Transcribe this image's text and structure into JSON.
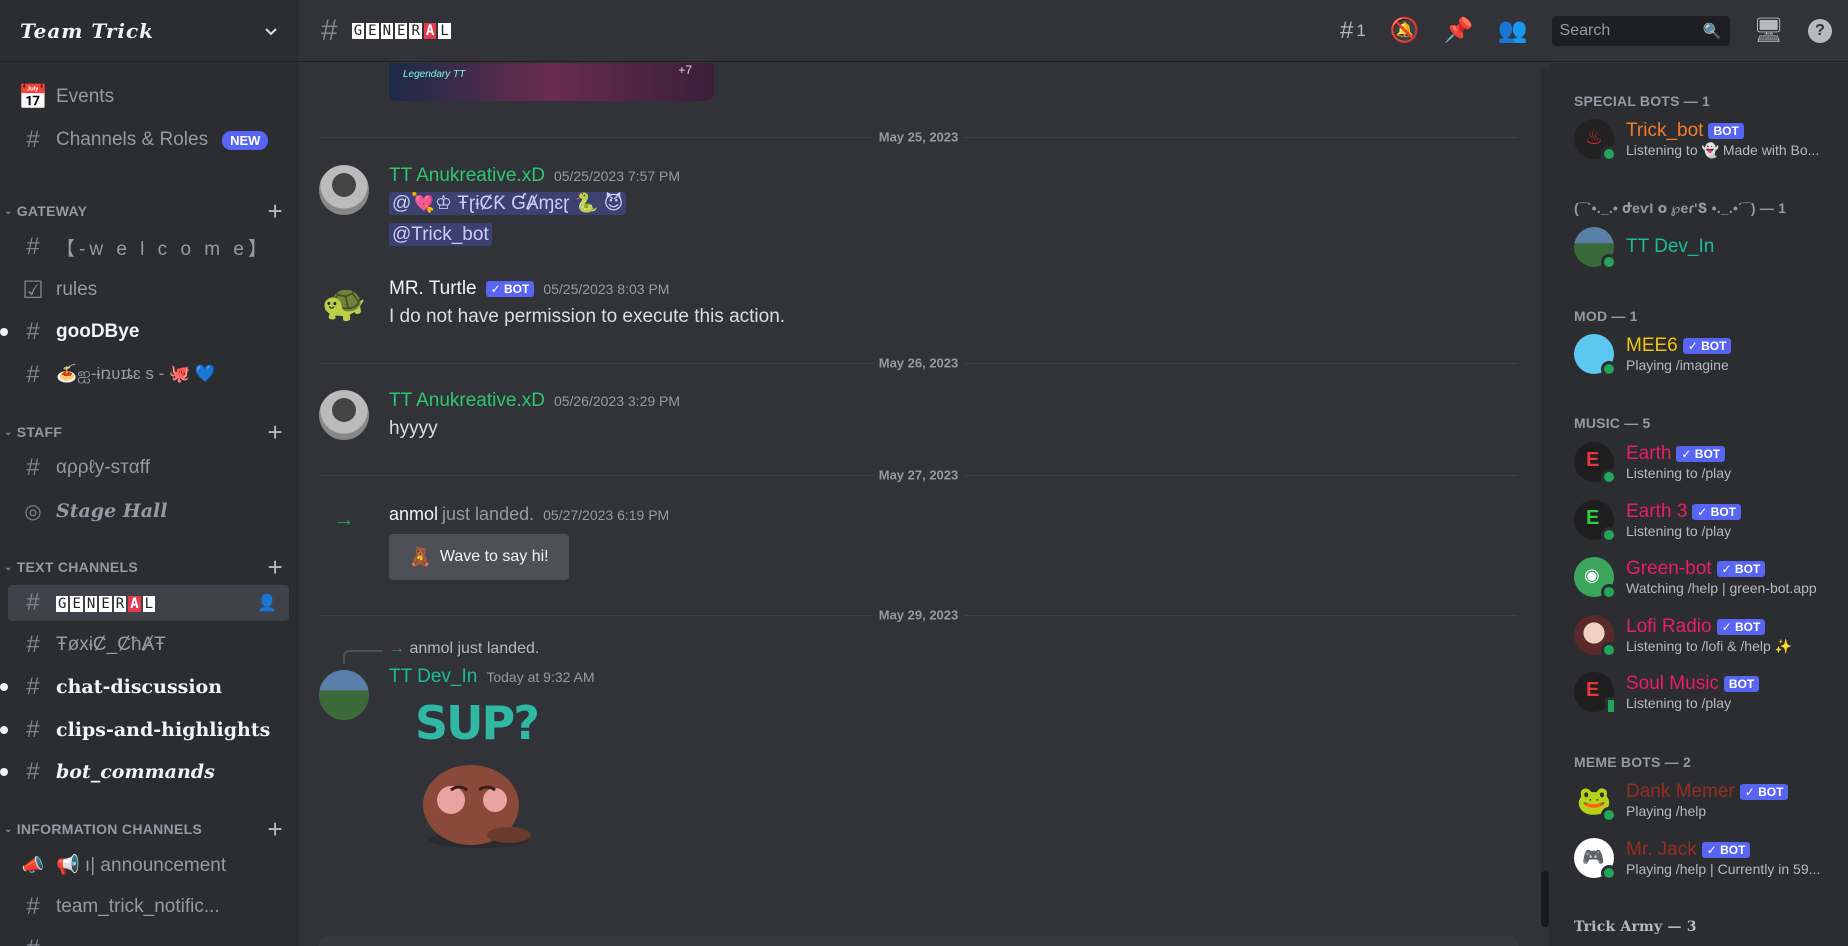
{
  "server": {
    "name": "Team Trick"
  },
  "sidebar": {
    "events_label": "Events",
    "channels_roles_label": "Channels & Roles",
    "new_badge": "NEW",
    "categories": {
      "gateway": "GATEWAY",
      "staff": "STAFF",
      "text_channels": "TEXT CHANNELS",
      "information_channels": "INFORMATION CHANNELS"
    },
    "channels": {
      "welcome": "【-w e l c o m e】",
      "rules": "rules",
      "goodbye": "gooDBye",
      "invites": "🍝ஐ-ɨռʋɪȶɛ ѕ - 🐙 💙",
      "apply_staff": "αρρℓу-ѕтαff",
      "stage_hall": "Stage Hall",
      "general": "GENERAL",
      "toxic_chat": "ŦøxɨȻ_ȻħȺŦ",
      "chat_discussion": "chat-discussion",
      "clips": "clips-and-highlights",
      "bot_commands": "bot_commands",
      "announcement": "📢 ı| announcement",
      "notifications": "team_trick_notific..."
    }
  },
  "topbar": {
    "channel": "GENERAL",
    "threads_count": "1",
    "search_placeholder": "Search"
  },
  "chat": {
    "embed_text": "Legendary TT",
    "embed_more": "+7",
    "dividers": [
      "May 25, 2023",
      "May 26, 2023",
      "May 27, 2023",
      "May 29, 2023"
    ],
    "messages": [
      {
        "author": "TT Anukreative.xD",
        "timestamp": "05/25/2023 7:57 PM",
        "mention1": "@💘♔ ŦɽɨȻƘ ƓȺɱɛɽ 🐍 😈",
        "mention2": "@Trick_bot"
      },
      {
        "author": "MR. Turtle",
        "bot": "✓ BOT",
        "timestamp": "05/25/2023 8:03 PM",
        "text": "I do not have permission to execute this action."
      },
      {
        "author": "TT Anukreative.xD",
        "timestamp": "05/26/2023 3:29 PM",
        "text": "hyyyy"
      },
      {
        "author": "anmol",
        "action": "just landed.",
        "timestamp": "05/27/2023 6:19 PM",
        "button": "Wave to say hi!"
      },
      {
        "reply": "anmol just landed.",
        "author": "TT Dev_In",
        "timestamp": "Today at 9:32 AM",
        "sticker_text": "SUP?"
      }
    ]
  },
  "members": {
    "groups": [
      {
        "title": "SPECIAL BOTS — 1"
      },
      {
        "title": "(¯`•._.• ժeѵӀ օ ℘eɾ'Տ •._.•´¯) — 1"
      },
      {
        "title": "MOD — 1"
      },
      {
        "title": "MUSIC — 5"
      },
      {
        "title": "MEME BOTS — 2"
      },
      {
        "title": "Trick Army — 3"
      }
    ],
    "list": [
      {
        "name": "Trick_bot",
        "bot": "BOT",
        "activity": "Listening to 👻 Made with Bo...",
        "color": "#f47b28"
      },
      {
        "name": "TT Dev_In",
        "activity": "",
        "color": "#1abc9c"
      },
      {
        "name": "MEE6",
        "bot": "✓ BOT",
        "activity": "Playing /imagine",
        "color": "#f1c40f"
      },
      {
        "name": "Earth",
        "bot": "✓ BOT",
        "activity": "Listening to /play",
        "color": "#e91e63"
      },
      {
        "name": "Earth 3",
        "bot": "✓ BOT",
        "activity": "Listening to /play",
        "color": "#e91e63"
      },
      {
        "name": "Green-bot",
        "bot": "✓ BOT",
        "activity": "Watching /help | green-bot.app",
        "color": "#e91e63"
      },
      {
        "name": "Lofi Radio",
        "bot": "✓ BOT",
        "activity": "Listening to /lofi & /help ✨",
        "color": "#e91e63"
      },
      {
        "name": "Soul Music",
        "bot": "BOT",
        "activity": "Listening to /play",
        "color": "#e91e63"
      },
      {
        "name": "Dank Memer",
        "bot": "✓ BOT",
        "activity": "Playing /help",
        "color": "#992d22"
      },
      {
        "name": "Mr. Jack",
        "bot": "✓ BOT",
        "activity": "Playing /help | Currently in 59...",
        "color": "#992d22"
      }
    ]
  },
  "colors": {
    "green_name": "#2dc770",
    "teal_name": "#1abc9c",
    "blurple": "#5865f2"
  }
}
